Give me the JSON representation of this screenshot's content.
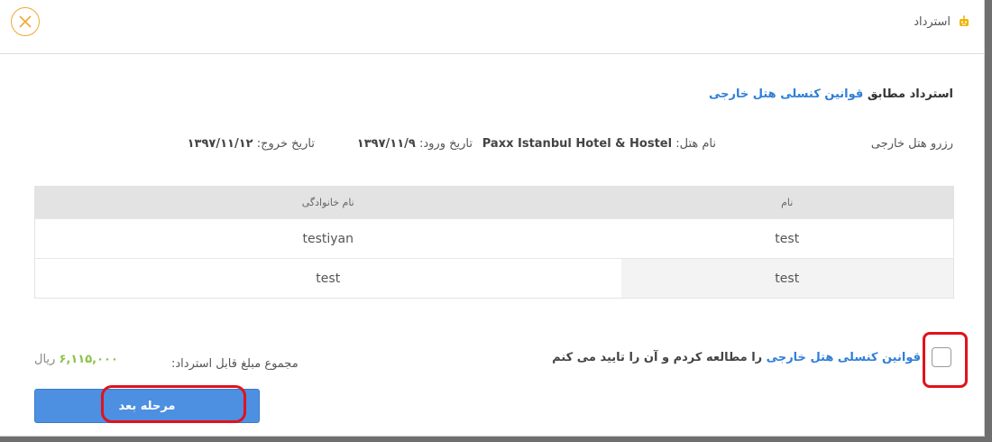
{
  "header": {
    "title": "استرداد",
    "close_icon": "close-x-icon",
    "title_icon": "robot-icon"
  },
  "policy": {
    "prefix": "استرداد مطابق",
    "link": "قوانین کنسلی هتل خارجی"
  },
  "booking": {
    "type_label": "رزرو هتل خارجی",
    "hotel_label": "نام هتل:",
    "hotel_name": "Paxx Istanbul Hotel & Hostel",
    "checkin_label": "تاریخ ورود:",
    "checkin_date": "۱۳۹۷/۱۱/۹",
    "checkout_label": "تاریخ خروج:",
    "checkout_date": "۱۳۹۷/۱۱/۱۲"
  },
  "table": {
    "headers": [
      "نام",
      "نام خانوادگی"
    ],
    "rows": [
      [
        "test",
        "testiyan"
      ],
      [
        "test",
        "test"
      ]
    ]
  },
  "agreement": {
    "link": "قوانین کنسلی هتل خارجی",
    "text": "را مطالعه کردم و آن را تایید می کنم",
    "checked": false
  },
  "total": {
    "label": "مجموع مبلغ قابل استرداد:",
    "amount": "۶,۱۱۵,۰۰۰",
    "currency": "ریال"
  },
  "actions": {
    "next_label": "مرحله بعد"
  },
  "colors": {
    "accent": "#4d8fe0",
    "link": "#2f7fd8",
    "close": "#f0a830",
    "amount": "#8bc34a",
    "highlight": "#e0131c"
  }
}
